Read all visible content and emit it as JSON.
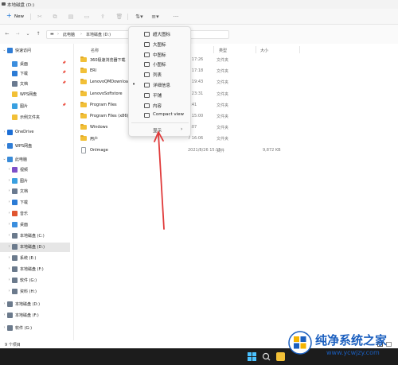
{
  "window": {
    "title": "本地磁盘 (D:)"
  },
  "toolbar": {
    "new_label": "New"
  },
  "address": {
    "crumbs": [
      "此电脑",
      "本地磁盘 (D:)"
    ]
  },
  "sidebar": {
    "items": [
      {
        "label": "快速访问",
        "icon": "star-icon",
        "color": "#2f7dd6"
      },
      {
        "label": "桌面",
        "icon": "desktop-icon",
        "color": "#3b8ede"
      },
      {
        "label": "下载",
        "icon": "download-icon",
        "color": "#2b7bd5"
      },
      {
        "label": "文档",
        "icon": "document-icon",
        "color": "#6a7a90"
      },
      {
        "label": "WPS网盘",
        "icon": "folder-icon",
        "color": "#f2c037"
      },
      {
        "label": "图片",
        "icon": "picture-icon",
        "color": "#3aa0e0"
      },
      {
        "label": "示例文件夹",
        "icon": "folder-icon",
        "color": "#f2c037"
      },
      {
        "label": "OneDrive",
        "icon": "cloud-icon",
        "color": "#1d6fd6"
      },
      {
        "label": "WPS网盘",
        "icon": "cloud-icon",
        "color": "#2f7dd6"
      },
      {
        "label": "此电脑",
        "icon": "computer-icon",
        "color": "#3a8bd8"
      },
      {
        "label": "视频",
        "icon": "video-icon",
        "color": "#7c4fc9"
      },
      {
        "label": "图片",
        "icon": "picture-icon",
        "color": "#3aa0e0"
      },
      {
        "label": "文档",
        "icon": "document-icon",
        "color": "#6a7a90"
      },
      {
        "label": "下载",
        "icon": "download-icon",
        "color": "#2b7bd5"
      },
      {
        "label": "音乐",
        "icon": "music-icon",
        "color": "#e0552f"
      },
      {
        "label": "桌面",
        "icon": "desktop-icon",
        "color": "#3b8ede"
      },
      {
        "label": "本地磁盘 (C:)",
        "icon": "drive-icon",
        "color": "#6b7a8c"
      },
      {
        "label": "本地磁盘 (D:)",
        "icon": "drive-icon",
        "color": "#6b7a8c"
      },
      {
        "label": "系统 (E:)",
        "icon": "drive-icon",
        "color": "#6b7a8c"
      },
      {
        "label": "本地磁盘 (F:)",
        "icon": "drive-icon",
        "color": "#6b7a8c"
      },
      {
        "label": "软件 (G:)",
        "icon": "drive-icon",
        "color": "#6b7a8c"
      },
      {
        "label": "资料 (H:)",
        "icon": "drive-icon",
        "color": "#6b7a8c"
      },
      {
        "label": "本地磁盘 (D:)",
        "icon": "drive-icon",
        "color": "#6b7a8c"
      },
      {
        "label": "本地磁盘 (F:)",
        "icon": "drive-icon",
        "color": "#6b7a8c"
      },
      {
        "label": "软件 (G:)",
        "icon": "drive-icon",
        "color": "#6b7a8c"
      }
    ]
  },
  "columns": {
    "name": "名称",
    "type": "类型",
    "size": "大小"
  },
  "files": [
    {
      "name": "360极速浏览器下载",
      "date": "3 17:26",
      "type": "文件夹",
      "size": "",
      "icon": "folder-icon"
    },
    {
      "name": "ERI",
      "date": "5 17:18",
      "type": "文件夹",
      "size": "",
      "icon": "folder-icon"
    },
    {
      "name": "LenovoQMDownload",
      "date": "6 19:43",
      "type": "文件夹",
      "size": "",
      "icon": "folder-icon"
    },
    {
      "name": "LenovoSoftstore",
      "date": "8 23:31",
      "type": "文件夹",
      "size": "",
      "icon": "folder-icon"
    },
    {
      "name": "Program Files",
      "date": "2:41",
      "type": "文件夹",
      "size": "",
      "icon": "folder-icon"
    },
    {
      "name": "Program Files (x86)",
      "date": "6 15:00",
      "type": "文件夹",
      "size": "",
      "icon": "folder-icon"
    },
    {
      "name": "Windows",
      "date": "4:07",
      "type": "文件夹",
      "size": "",
      "icon": "folder-icon"
    },
    {
      "name": "用户",
      "date": "7 16:06",
      "type": "文件夹",
      "size": "",
      "icon": "folder-icon"
    },
    {
      "name": "OnImage",
      "date": "2021/8/26 15:15",
      "type": "文件",
      "size": "9,872 KB",
      "icon": "file-icon"
    }
  ],
  "view_menu": {
    "items": [
      {
        "label": "超大图标",
        "icon": "extra-large-icons-icon",
        "checked": false
      },
      {
        "label": "大图标",
        "icon": "large-icons-icon",
        "checked": false
      },
      {
        "label": "中图标",
        "icon": "medium-icons-icon",
        "checked": false
      },
      {
        "label": "小图标",
        "icon": "small-icons-icon",
        "checked": false
      },
      {
        "label": "列表",
        "icon": "list-view-icon",
        "checked": false
      },
      {
        "label": "详细信息",
        "icon": "details-view-icon",
        "checked": true
      },
      {
        "label": "平铺",
        "icon": "tiles-view-icon",
        "checked": false
      },
      {
        "label": "内容",
        "icon": "content-view-icon",
        "checked": false
      },
      {
        "label": "Compact view",
        "icon": "compact-view-icon",
        "checked": false
      }
    ],
    "show_label": "显示"
  },
  "status": {
    "item_count": "9 个项目"
  },
  "annotation": {
    "arrow_color": "#e03a3a",
    "highlight": "显示"
  },
  "watermark": {
    "title": "纯净系统之家",
    "url": "www.ycwjzy.com"
  },
  "colors": {
    "accent": "#1a73d6",
    "folder": "#f2c037",
    "taskbar": "#1c1c1c"
  }
}
